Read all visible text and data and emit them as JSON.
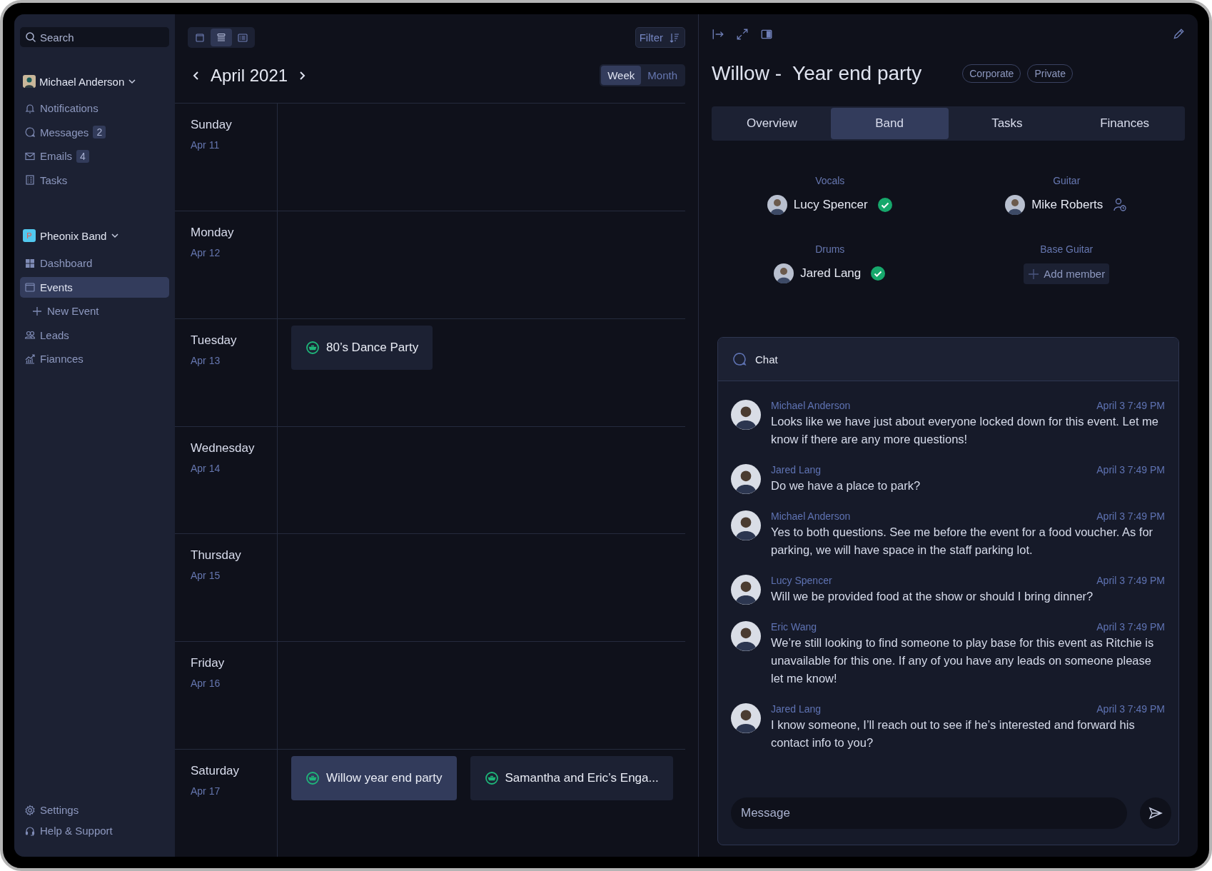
{
  "sidebar": {
    "search": {
      "placeholder": "Search"
    },
    "user": {
      "name": "Michael Anderson"
    },
    "items": [
      {
        "label": "Notifications",
        "kind": "bell"
      },
      {
        "label": "Messages",
        "kind": "chat",
        "badge": "2"
      },
      {
        "label": "Emails",
        "kind": "mail",
        "badge": "4"
      },
      {
        "label": "Tasks",
        "kind": "tasks"
      }
    ],
    "workspace": {
      "initial": "P",
      "name": "Pheonix Band"
    },
    "nav": [
      {
        "label": "Dashboard",
        "kind": "grid",
        "selected": false
      },
      {
        "label": "Events",
        "kind": "calendar",
        "selected": true,
        "children": [
          {
            "label": "New Event",
            "kind": "plus",
            "selected": false
          }
        ]
      },
      {
        "label": "Leads",
        "kind": "people",
        "selected": false
      },
      {
        "label": "Fiannces",
        "kind": "chart",
        "selected": false
      }
    ],
    "footer": [
      {
        "label": "Settings",
        "kind": "gear"
      },
      {
        "label": "Help & Support",
        "kind": "headset"
      }
    ]
  },
  "calendar": {
    "views": [
      {
        "kind": "calendar",
        "selected": false
      },
      {
        "kind": "rows",
        "selected": true
      },
      {
        "kind": "list",
        "selected": false
      }
    ],
    "filter": "Filter",
    "month": "April 2021",
    "ranges": [
      {
        "label": "Week",
        "selected": true
      },
      {
        "label": "Month",
        "selected": false
      }
    ],
    "days": [
      {
        "name": "Sunday",
        "date": "Apr 11"
      },
      {
        "name": "Monday",
        "date": "Apr 12"
      },
      {
        "name": "Tuesday",
        "date": "Apr 13",
        "events": [
          {
            "title": "80’s Dance Party",
            "selected": false
          }
        ]
      },
      {
        "name": "Wednesday",
        "date": "Apr 14"
      },
      {
        "name": "Thursday",
        "date": "Apr 15"
      },
      {
        "name": "Friday",
        "date": "Apr 16"
      },
      {
        "name": "Saturday",
        "date": "Apr 17",
        "events": [
          {
            "title": "Willow year end party",
            "selected": true
          },
          {
            "title": "Samantha and Eric’s Enga...",
            "selected": false
          }
        ]
      }
    ]
  },
  "panel": {
    "title": "Willow -  Year end party",
    "tags": [
      "Corporate",
      "Private"
    ],
    "tabs": [
      {
        "label": "Overview",
        "selected": false
      },
      {
        "label": "Band",
        "selected": true
      },
      {
        "label": "Tasks",
        "selected": false
      },
      {
        "label": "Finances",
        "selected": false
      }
    ],
    "band": [
      {
        "role": "Vocals",
        "kind": "member",
        "name": "Lucy Spencer",
        "confirmed": true
      },
      {
        "role": "Guitar",
        "kind": "member",
        "name": "Mike Roberts",
        "confirmed": false
      },
      {
        "role": "Drums",
        "kind": "member",
        "name": "Jared Lang",
        "confirmed": true
      },
      {
        "role": "Base Guitar",
        "kind": "open",
        "action": "Add member"
      }
    ],
    "chat": {
      "title": "Chat",
      "messages": [
        {
          "author": "Michael Anderson",
          "time": "April 3 7:49 PM",
          "text": "Looks like we have just about everyone locked down for this event. Let me know if there are any more questions!"
        },
        {
          "author": "Jared Lang",
          "time": "April 3 7:49 PM",
          "text": "Do we have a place to park?"
        },
        {
          "author": "Michael Anderson",
          "time": "April 3 7:49 PM",
          "text": "Yes to both questions. See me before the event for a food voucher. As for parking, we will have space in the staff parking lot."
        },
        {
          "author": "Lucy Spencer",
          "time": "April 3 7:49 PM",
          "text": "Will we be provided food at the show or should I bring dinner?"
        },
        {
          "author": "Eric Wang",
          "time": "April 3 7:49 PM",
          "text": "We’re still looking to find someone to play base for this event as Ritchie is unavailable for this one. If any of you have any leads on someone please let me know!"
        },
        {
          "author": "Jared Lang",
          "time": "April 3 7:49 PM",
          "text": "I know someone, I’ll reach out to see if he’s interested and forward his contact info to you?"
        }
      ],
      "input": {
        "placeholder": "Message"
      }
    }
  }
}
